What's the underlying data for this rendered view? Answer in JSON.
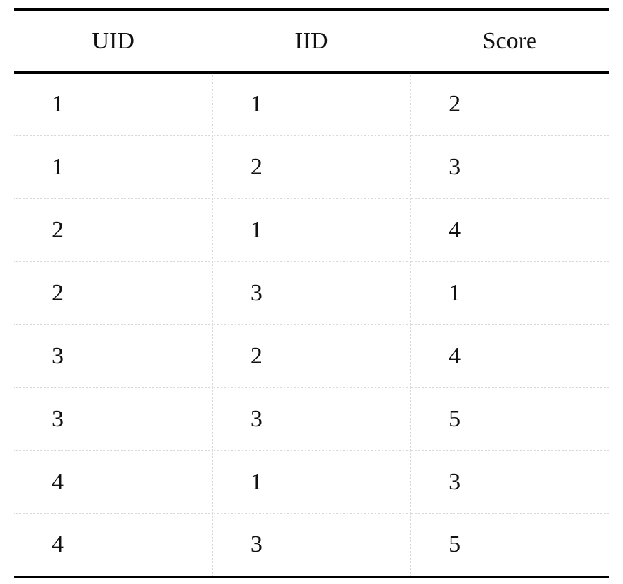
{
  "chart_data": {
    "type": "table",
    "headers": [
      "UID",
      "IID",
      "Score"
    ],
    "rows": [
      [
        1,
        1,
        2
      ],
      [
        1,
        2,
        3
      ],
      [
        2,
        1,
        4
      ],
      [
        2,
        3,
        1
      ],
      [
        3,
        2,
        4
      ],
      [
        3,
        3,
        5
      ],
      [
        4,
        1,
        3
      ],
      [
        4,
        3,
        5
      ]
    ]
  }
}
